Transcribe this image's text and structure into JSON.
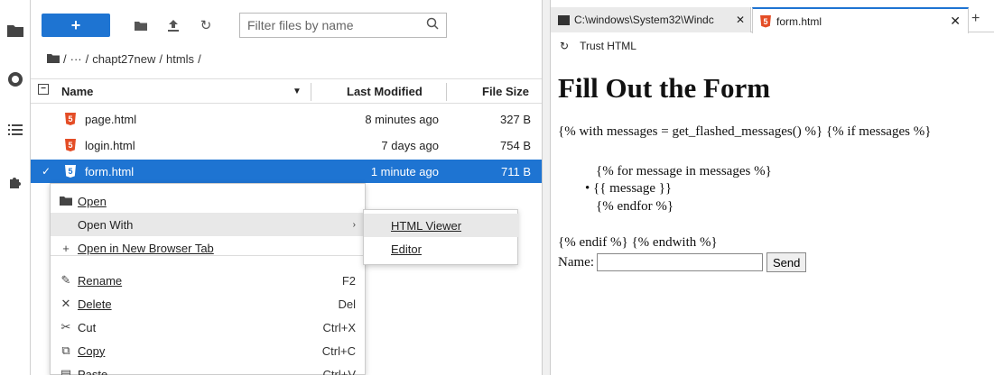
{
  "file_browser": {
    "new_label": "+",
    "filter_placeholder": "Filter files by name",
    "breadcrumb": {
      "ellipsis": "···",
      "sep1": "/",
      "folder": "chapt27new",
      "sep2": "/",
      "sub": "htmls",
      "sep3": "/",
      "lead": "/"
    },
    "columns": {
      "name": "Name",
      "modified": "Last Modified",
      "size": "File Size"
    },
    "files": [
      {
        "name": "page.html",
        "modified": "8 minutes ago",
        "size": "327 B",
        "selected": false
      },
      {
        "name": "login.html",
        "modified": "7 days ago",
        "size": "754 B",
        "selected": false
      },
      {
        "name": "form.html",
        "modified": "1 minute ago",
        "size": "711 B",
        "selected": true
      }
    ]
  },
  "context_menu": {
    "items": [
      {
        "label": "Open",
        "shortcut": "",
        "icon": "folder-icon"
      },
      {
        "label": "Open With",
        "shortcut": "",
        "icon": ""
      },
      {
        "label": "Open in New Browser Tab",
        "shortcut": "",
        "icon": "plus-icon"
      },
      {
        "label": "Rename",
        "shortcut": "F2",
        "icon": "pencil-icon"
      },
      {
        "label": "Delete",
        "shortcut": "Del",
        "icon": "close-icon"
      },
      {
        "label": "Cut",
        "shortcut": "Ctrl+X",
        "icon": "scissors-icon"
      },
      {
        "label": "Copy",
        "shortcut": "Ctrl+C",
        "icon": "copy-icon"
      },
      {
        "label": "Paste",
        "shortcut": "Ctrl+V",
        "icon": "paste-icon"
      }
    ],
    "submenu": [
      {
        "label": "HTML Viewer"
      },
      {
        "label": "Editor"
      }
    ]
  },
  "viewer": {
    "tabs": [
      {
        "label": "C:\\windows\\System32\\Windc",
        "active": false
      },
      {
        "label": "form.html",
        "active": true
      }
    ],
    "trust_label": "Trust HTML",
    "heading": "Fill Out the Form",
    "line1": "{% with messages = get_flashed_messages() %} {% if messages %}",
    "for_line": "{% for message in messages %}",
    "message_line": "{{ message }}",
    "endfor_line": "{% endfor %}",
    "endif_line": "{% endif %} {% endwith %}",
    "name_label": "Name:",
    "send_label": "Send"
  },
  "colors": {
    "accent": "#1e74d2",
    "html5": "#e44d26"
  }
}
